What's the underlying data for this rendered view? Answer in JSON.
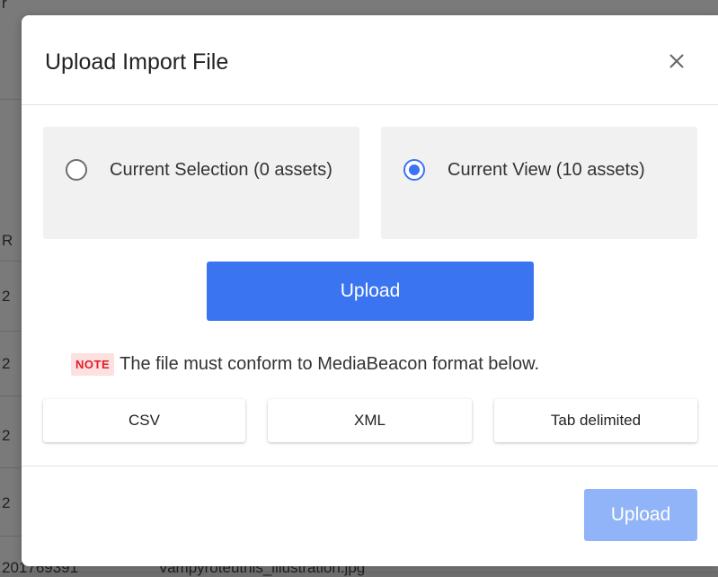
{
  "background": {
    "rows": [
      "2",
      "2",
      "2",
      "2"
    ],
    "partial_letter": "R",
    "partial_top": "r",
    "bottom_id": "201769391",
    "bottom_file": "Vampyroteuthis_illustration.jpg"
  },
  "dialog": {
    "title": "Upload Import File",
    "close_icon": "close-icon",
    "options": [
      {
        "label": "Current Selection (0 assets)",
        "selected": false
      },
      {
        "label": "Current View (10 assets)",
        "selected": true
      }
    ],
    "upload_label": "Upload",
    "note_badge": "NOTE",
    "note_text": "The file must conform to MediaBeacon format below.",
    "formats": [
      "CSV",
      "XML",
      "Tab delimited"
    ],
    "footer_upload_label": "Upload"
  },
  "colors": {
    "accent": "#3b74f0",
    "accent_disabled": "#90b4f7",
    "note_red": "#e11d2a"
  }
}
